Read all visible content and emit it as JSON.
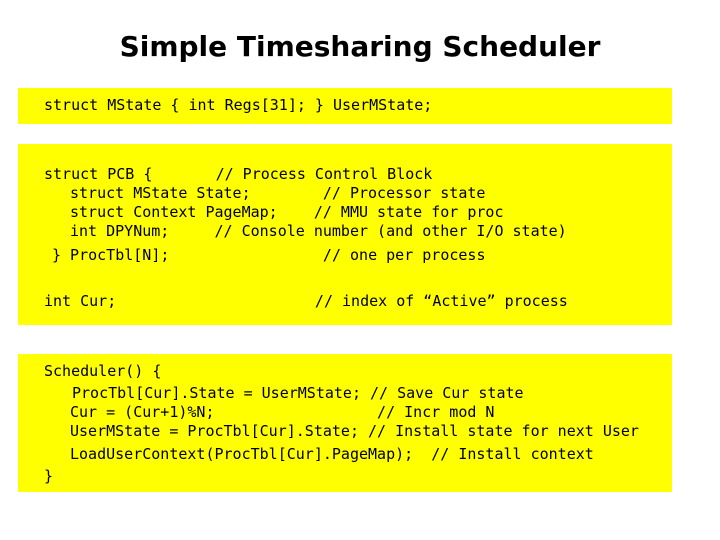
{
  "title": "Simple Timesharing Scheduler",
  "box1": {
    "lines": [
      "struct MState { int Regs[31]; } UserMState;"
    ]
  },
  "box2": {
    "lines": [
      "struct PCB {       // Process Control Block",
      "struct MState State;        // Processor state",
      "struct Context PageMap;    // MMU state for proc",
      "int DPYNum;     // Console number (and other I/O state)",
      "} ProcTbl[N];                 // one per process",
      "int Cur;                      // index of “Active” process"
    ]
  },
  "box3": {
    "lines": [
      "Scheduler() {",
      "ProcTbl[Cur].State = UserMState; // Save Cur state",
      "Cur = (Cur+1)%N;                  // Incr mod N",
      "UserMState = ProcTbl[Cur].State; // Install state for next User",
      "LoadUserContext(ProcTbl[Cur].PageMap);  // Install context",
      "}"
    ]
  }
}
